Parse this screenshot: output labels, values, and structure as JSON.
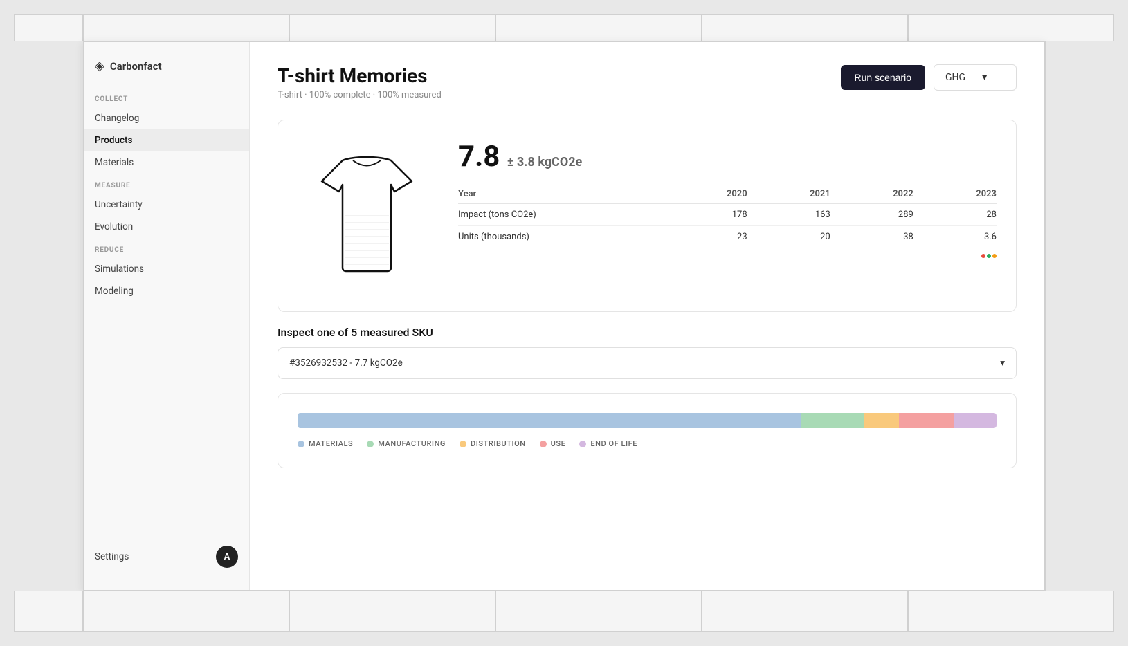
{
  "app": {
    "logo_icon": "◈",
    "logo_text": "Carbonfact"
  },
  "sidebar": {
    "sections": [
      {
        "label": "COLLECT",
        "items": [
          {
            "id": "changelog",
            "label": "Changelog",
            "active": false
          },
          {
            "id": "products",
            "label": "Products",
            "active": true
          },
          {
            "id": "materials",
            "label": "Materials",
            "active": false
          }
        ]
      },
      {
        "label": "MEASURE",
        "items": [
          {
            "id": "uncertainty",
            "label": "Uncertainty",
            "active": false
          },
          {
            "id": "evolution",
            "label": "Evolution",
            "active": false
          }
        ]
      },
      {
        "label": "REDUCE",
        "items": [
          {
            "id": "simulations",
            "label": "Simulations",
            "active": false
          },
          {
            "id": "modeling",
            "label": "Modeling",
            "active": false
          }
        ]
      }
    ],
    "settings_label": "Settings",
    "avatar_initials": "A"
  },
  "header": {
    "title": "T-shirt Memories",
    "subtitle": "T-shirt · 100% complete · 100% measured",
    "run_scenario_label": "Run scenario",
    "ghg_label": "GHG"
  },
  "product_card": {
    "carbon_value": "7.8",
    "carbon_uncertainty": "± 3.8 kgCO2e",
    "table": {
      "columns": [
        "Year",
        "2020",
        "2021",
        "2022",
        "2023"
      ],
      "rows": [
        {
          "label": "Impact (tons CO2e)",
          "values": [
            "178",
            "163",
            "289",
            "28"
          ]
        },
        {
          "label": "Units (thousands)",
          "values": [
            "23",
            "20",
            "38",
            "3.6"
          ]
        }
      ]
    },
    "color_dots": [
      {
        "color": "#e74c3c"
      },
      {
        "color": "#27ae60"
      },
      {
        "color": "#f39c12"
      }
    ]
  },
  "sku_section": {
    "title": "Inspect one of 5 measured SKU",
    "selected_sku": "#3526932532 - 7.7 kgCO2e"
  },
  "bar_chart": {
    "segments": [
      {
        "label": "MATERIALS",
        "color": "#a8c4e0",
        "width": 72
      },
      {
        "label": "MANUFACTURING",
        "color": "#a8dab5",
        "width": 9
      },
      {
        "label": "DISTRIBUTION",
        "color": "#f9c97c",
        "width": 5
      },
      {
        "label": "USE",
        "color": "#f4a0a0",
        "width": 8
      },
      {
        "label": "END OF LIFE",
        "color": "#d4b8e0",
        "width": 6
      }
    ]
  }
}
